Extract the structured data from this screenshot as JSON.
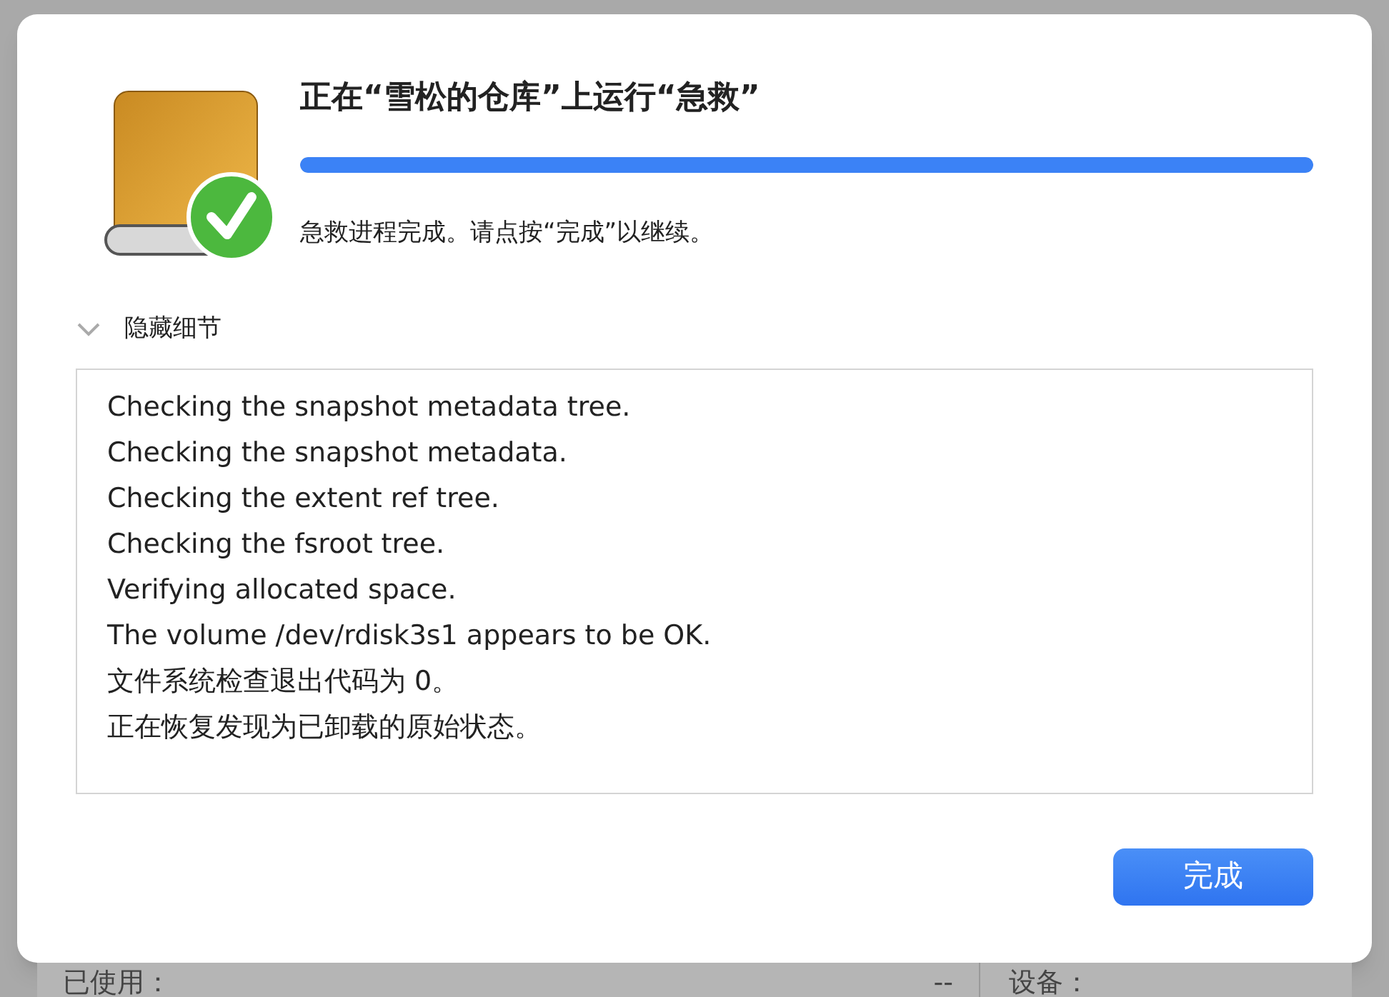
{
  "dialog": {
    "title": "正在“雪松的仓库”上运行“急救”",
    "progress": {
      "level": 1
    },
    "message": "急救进程完成。请点按“完成”以继续。",
    "details_toggle": {
      "label": "隐藏细节",
      "expanded": true
    },
    "log": [
      "Checking the snapshot metadata tree.",
      "Checking the snapshot metadata.",
      "Checking the extent ref tree.",
      "Checking the fsroot tree.",
      "Verifying allocated space.",
      "The volume /dev/rdisk3s1 appears to be OK.",
      "文件系统检查退出代码为 0。",
      "正在恢复发现为已卸载的原始状态。"
    ],
    "done_button": "完成"
  },
  "background_window": {
    "used_label": "已使用：",
    "used_value": "--",
    "device_label": "设备："
  }
}
